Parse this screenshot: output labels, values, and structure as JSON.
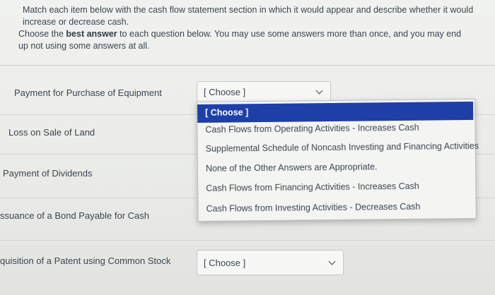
{
  "instructions": {
    "line1": "Match each item below with the cash flow statement section in which it would appear and describe whether it would increase or decrease cash.",
    "line2_prefix": "Choose the ",
    "line2_bold": "best answer",
    "line2_suffix": " to each question below. You may use some answers more than once, and you may end up not using some answers at all."
  },
  "rows": [
    {
      "label": "Payment for Purchase of Equipment",
      "selected": "[ Choose ]"
    },
    {
      "label": "Loss on Sale of Land"
    },
    {
      "label": "Payment of Dividends"
    },
    {
      "label": "ssuance of a Bond Payable for Cash"
    },
    {
      "label": "quisition of a Patent using Common Stock",
      "selected": "[ Choose ]"
    }
  ],
  "dropdown": {
    "options": [
      "[ Choose ]",
      "Cash Flows from Operating Activities - Increases Cash",
      "Supplemental Schedule of Noncash Investing and Financing Activities",
      "None of the Other Answers are Appropriate.",
      "Cash Flows from Financing Activities - Increases Cash",
      "Cash Flows from Investing Activities - Decreases Cash"
    ],
    "highlighted_index": 0
  },
  "colors": {
    "highlight": "#1f3fa8",
    "text": "#3a4650"
  }
}
